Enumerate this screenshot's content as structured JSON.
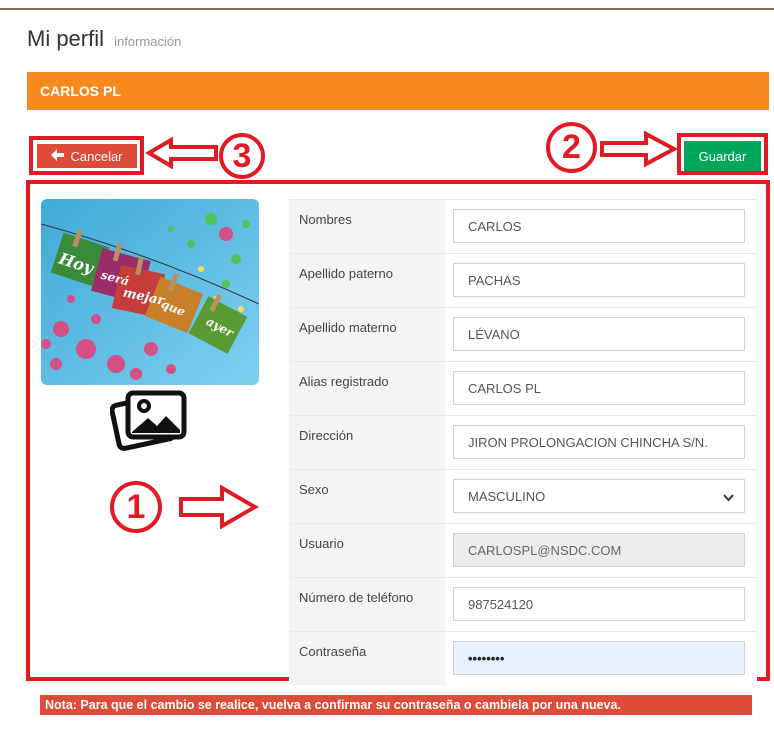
{
  "header": {
    "title": "Mi perfil",
    "subtitle": "información"
  },
  "panel": {
    "title": "CARLOS PL"
  },
  "buttons": {
    "cancel_label": "Cancelar",
    "save_label": "Guardar"
  },
  "annotations": {
    "n1": "1",
    "n2": "2",
    "n3": "3"
  },
  "photo": {
    "words": [
      "Hoy",
      "será",
      "mejar",
      "que",
      "ayer"
    ]
  },
  "form": {
    "rows": [
      {
        "label": "Nombres",
        "value": "CARLOS"
      },
      {
        "label": "Apellido paterno",
        "value": "PACHAS"
      },
      {
        "label": "Apellido materno",
        "value": "LÉVANO"
      },
      {
        "label": "Alias registrado",
        "value": "CARLOS PL"
      },
      {
        "label": "Dirección",
        "value": "JIRON PROLONGACION CHINCHA S/N."
      },
      {
        "label": "Sexo",
        "value": "MASCULINO"
      },
      {
        "label": "Usuario",
        "value": "CARLOSPL@NSDC.COM"
      },
      {
        "label": "Número de teléfono",
        "value": "987524120"
      },
      {
        "label": "Contraseña",
        "value": "••••••••"
      }
    ]
  },
  "note": "Nota: Para que el cambio se realice, vuelva a confirmar su contraseña o cambiela por una nueva.",
  "colors": {
    "accent": "#f7891e",
    "danger": "#dd4b39",
    "success": "#00a65a",
    "annotation": "#e01b24"
  }
}
